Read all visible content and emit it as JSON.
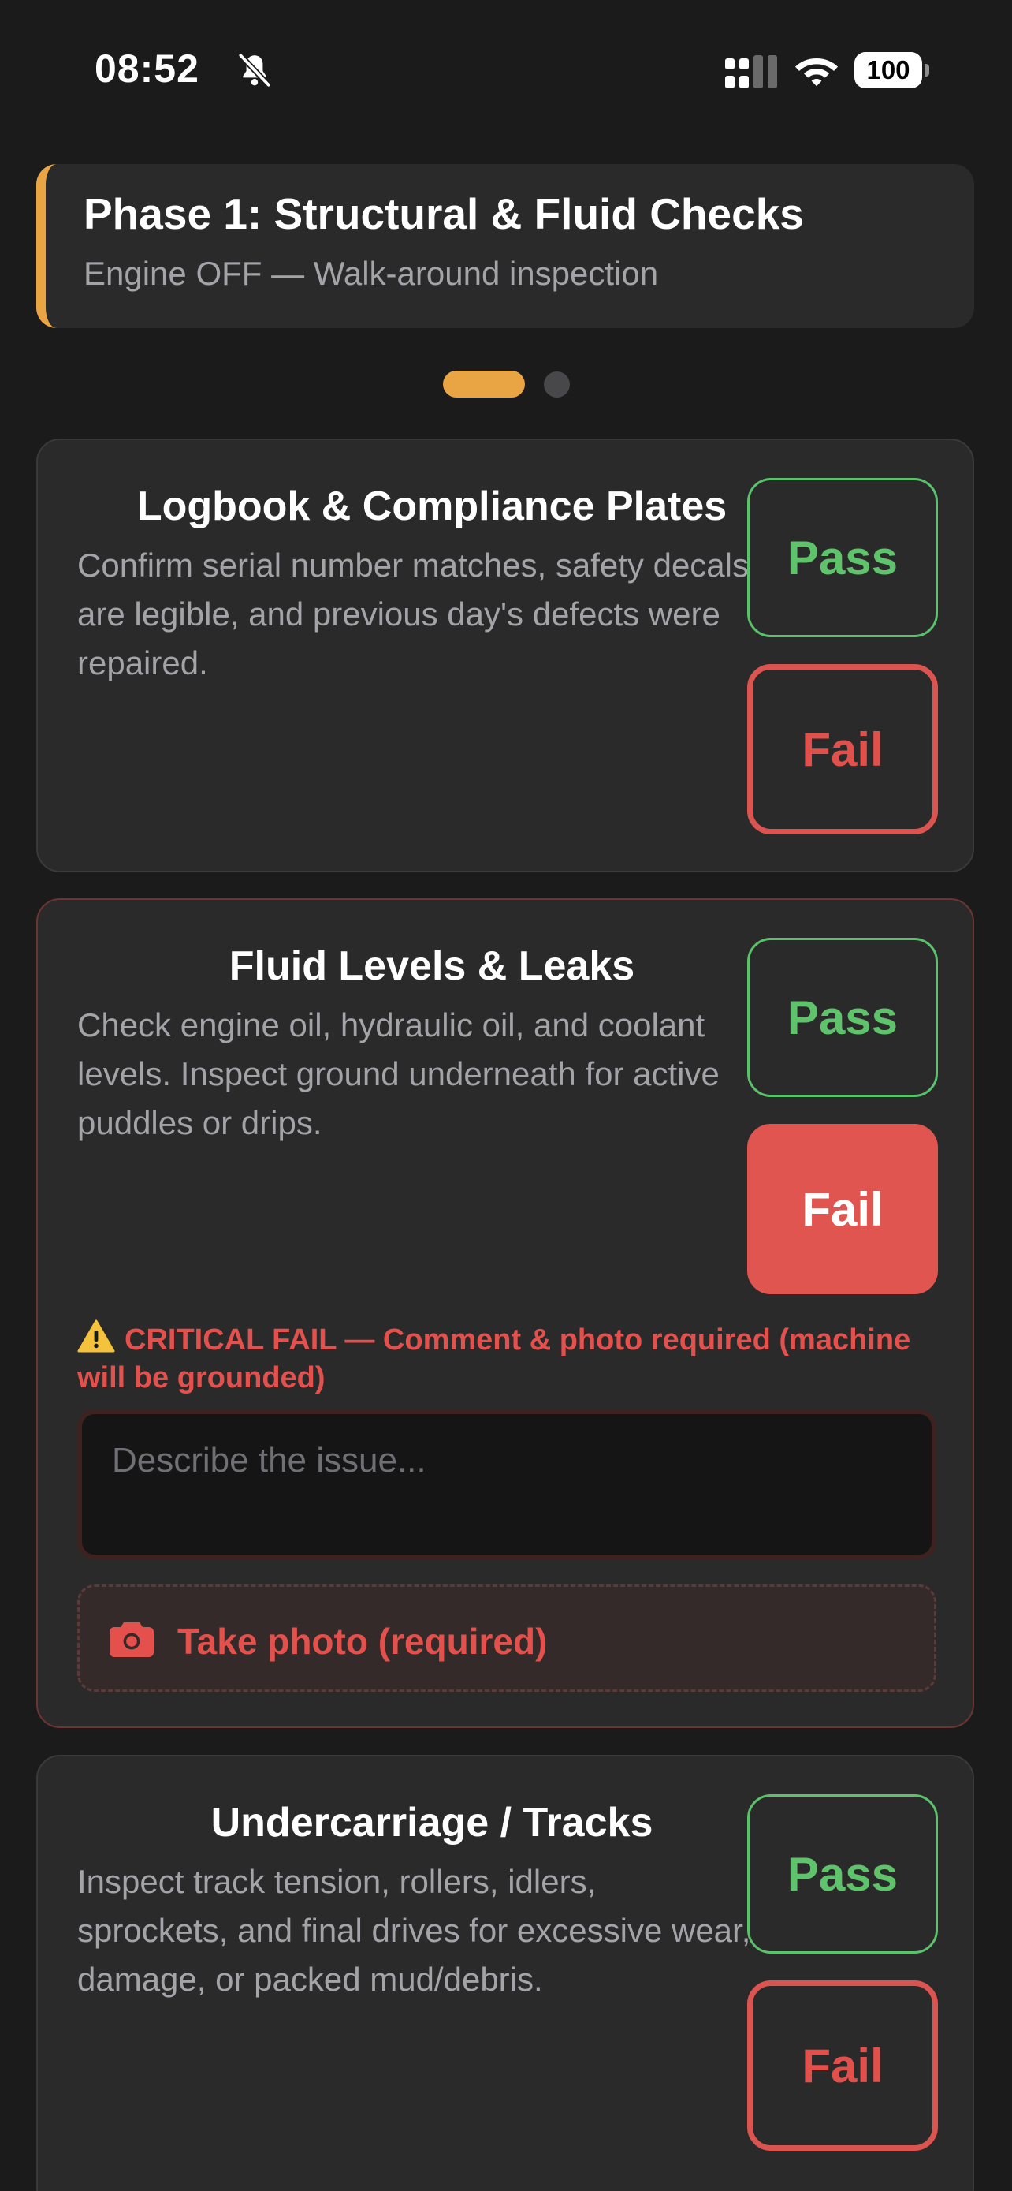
{
  "status_bar": {
    "time": "08:52",
    "battery": "100"
  },
  "phase": {
    "title": "Phase 1: Structural & Fluid Checks",
    "subtitle": "Engine OFF — Walk-around inspection",
    "accent_color": "#e9a544",
    "pages": 2,
    "current_page": 1
  },
  "checks": [
    {
      "title": "Logbook & Compliance Plates",
      "description": "Confirm serial number matches, safety decals are legible, and previous day's defects were repaired.",
      "pass_label": "Pass",
      "fail_label": "Fail",
      "state": "unset"
    },
    {
      "title": "Fluid Levels & Leaks",
      "description": "Check engine oil, hydraulic oil, and coolant levels. Inspect ground underneath for active puddles or drips.",
      "pass_label": "Pass",
      "fail_label": "Fail",
      "state": "fail",
      "warning": "CRITICAL FAIL — Comment & photo required (machine will be grounded)",
      "comment_placeholder": "Describe the issue...",
      "comment_value": "",
      "photo_label": "Take photo (required)"
    },
    {
      "title": "Undercarriage / Tracks",
      "description": "Inspect track tension, rollers, idlers, sprockets, and final drives for excessive wear, damage, or packed mud/debris.",
      "pass_label": "Pass",
      "fail_label": "Fail",
      "state": "unset"
    }
  ],
  "colors": {
    "pass": "#5ec36a",
    "fail": "#e05550",
    "card": "#2a2a2b",
    "background": "#1b1b1c"
  }
}
